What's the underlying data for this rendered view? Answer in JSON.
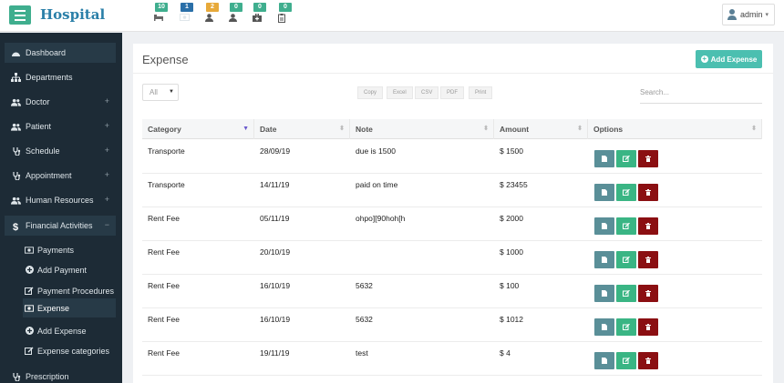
{
  "brand": "Hospital",
  "notifications": [
    {
      "count": "10",
      "color": "#3fae8e",
      "icon": "bed-icon"
    },
    {
      "count": "1",
      "color": "#2a6fa8",
      "icon": "money-icon"
    },
    {
      "count": "2",
      "color": "#e7a93a",
      "icon": "user-icon"
    },
    {
      "count": "0",
      "color": "#3fae8e",
      "icon": "user-icon"
    },
    {
      "count": "0",
      "color": "#3fae8e",
      "icon": "medkit-icon"
    },
    {
      "count": "0",
      "color": "#3fae8e",
      "icon": "clipboard-icon"
    }
  ],
  "user": {
    "name": "admin",
    "icon": "user-avatar-icon"
  },
  "sidebar": {
    "items": [
      {
        "label": "Dashboard",
        "icon": "dashboard-icon",
        "expandable": false
      },
      {
        "label": "Departments",
        "icon": "sitemap-icon",
        "expandable": false
      },
      {
        "label": "Doctor",
        "icon": "users-icon",
        "expandable": true,
        "toggle": "+"
      },
      {
        "label": "Patient",
        "icon": "users-icon",
        "expandable": true,
        "toggle": "+"
      },
      {
        "label": "Schedule",
        "icon": "stethoscope-icon",
        "expandable": true,
        "toggle": "+"
      },
      {
        "label": "Appointment",
        "icon": "stethoscope-icon",
        "expandable": true,
        "toggle": "+"
      },
      {
        "label": "Human Resources",
        "icon": "users-icon",
        "expandable": true,
        "toggle": "+"
      },
      {
        "label": "Financial Activities",
        "icon": "dollar-icon",
        "expandable": true,
        "toggle": "−"
      },
      {
        "label": "Prescription",
        "icon": "stethoscope-icon",
        "expandable": false
      }
    ],
    "subitems": [
      {
        "label": "Payments",
        "icon": "money-icon"
      },
      {
        "label": "Add Payment",
        "icon": "plus-circle-icon"
      },
      {
        "label": "Payment Procedures",
        "icon": "edit-icon"
      },
      {
        "label": "Expense",
        "icon": "money-icon"
      },
      {
        "label": "Add Expense",
        "icon": "plus-circle-icon"
      },
      {
        "label": "Expense categories",
        "icon": "edit-icon"
      }
    ]
  },
  "page": {
    "title": "Expense",
    "add_button": "Add Expense"
  },
  "table_controls": {
    "length_value": "All",
    "export_buttons": [
      "Copy",
      "Excel",
      "CSV",
      "PDF",
      "Print"
    ],
    "search_placeholder": "Search..."
  },
  "table": {
    "columns": [
      "Category",
      "Date",
      "Note",
      "Amount",
      "Options"
    ],
    "sorted_column": "Category",
    "rows": [
      {
        "category": "Transporte",
        "date": "28/09/19",
        "note": "due is 1500",
        "amount": "$ 1500"
      },
      {
        "category": "Transporte",
        "date": "14/11/19",
        "note": "paid on time",
        "amount": "$ 23455"
      },
      {
        "category": "Rent Fee",
        "date": "05/11/19",
        "note": "ohpo][90hoh[h",
        "amount": "$ 2000"
      },
      {
        "category": "Rent Fee",
        "date": "20/10/19",
        "note": "",
        "amount": "$ 1000"
      },
      {
        "category": "Rent Fee",
        "date": "16/10/19",
        "note": "5632",
        "amount": "$ 100"
      },
      {
        "category": "Rent Fee",
        "date": "16/10/19",
        "note": "5632",
        "amount": "$ 1012"
      },
      {
        "category": "Rent Fee",
        "date": "19/11/19",
        "note": "test",
        "amount": "$ 4"
      }
    ],
    "action_colors": {
      "view": "#5a8f98",
      "edit": "#3ab584",
      "delete": "#8b0f12"
    }
  },
  "colors": {
    "accent": "#3fae8e",
    "sidebar": "#1d2b36",
    "brand": "#2a7fa8"
  }
}
